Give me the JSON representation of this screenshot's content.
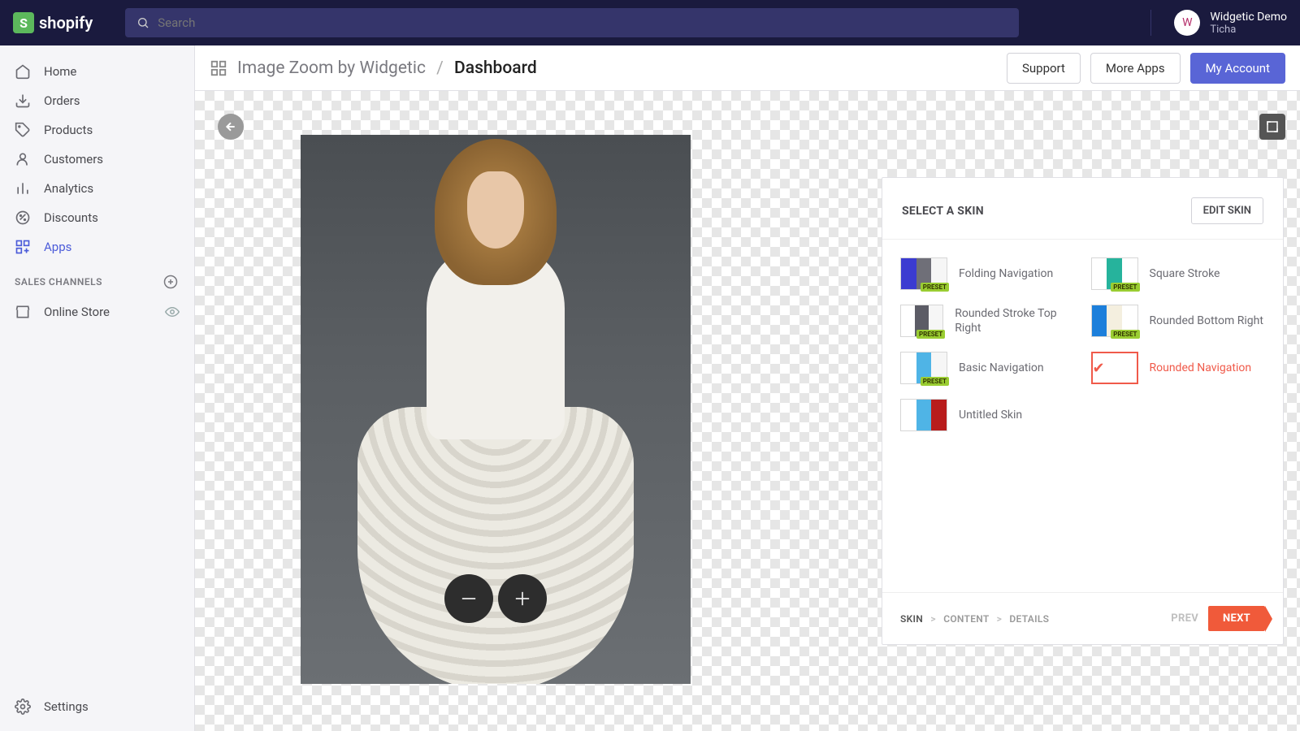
{
  "brand": "shopify",
  "search": {
    "placeholder": "Search"
  },
  "user": {
    "name": "Widgetic Demo",
    "store": "Ticha",
    "avatar_initial": "W"
  },
  "sidebar": {
    "items": [
      {
        "label": "Home"
      },
      {
        "label": "Orders"
      },
      {
        "label": "Products"
      },
      {
        "label": "Customers"
      },
      {
        "label": "Analytics"
      },
      {
        "label": "Discounts"
      },
      {
        "label": "Apps"
      }
    ],
    "section_title": "SALES CHANNELS",
    "channels": [
      {
        "label": "Online Store"
      }
    ],
    "settings_label": "Settings"
  },
  "breadcrumb": {
    "app": "Image Zoom by Widgetic",
    "current": "Dashboard"
  },
  "header_buttons": {
    "support": "Support",
    "more_apps": "More Apps",
    "my_account": "My Account"
  },
  "panel": {
    "title": "SELECT A SKIN",
    "edit_button": "EDIT SKIN",
    "preset_badge": "PRESET",
    "skins": [
      {
        "label": "Folding Navigation",
        "colors": [
          "#3b3bd1",
          "#6f6f78",
          "#f6f6f6"
        ],
        "preset": true
      },
      {
        "label": "Square Stroke",
        "colors": [
          "#ffffff",
          "#26b39c",
          "#ffffff"
        ],
        "preset": true
      },
      {
        "label": "Rounded Stroke Top Right",
        "colors": [
          "#ffffff",
          "#5c5c66",
          "#f6f6f6"
        ],
        "preset": true
      },
      {
        "label": "Rounded Bottom Right",
        "colors": [
          "#1c7fdb",
          "#f4efdf",
          "#ffffff"
        ],
        "preset": true
      },
      {
        "label": "Basic Navigation",
        "colors": [
          "#ffffff",
          "#4fb4e6",
          "#f6f6f6"
        ],
        "preset": true
      },
      {
        "label": "Rounded Navigation",
        "selected": true
      },
      {
        "label": "Untitled Skin",
        "colors": [
          "#ffffff",
          "#4fb4e6",
          "#b81c1c"
        ]
      }
    ],
    "steps": [
      "SKIN",
      "CONTENT",
      "DETAILS"
    ],
    "prev": "PREV",
    "next": "NEXT"
  }
}
